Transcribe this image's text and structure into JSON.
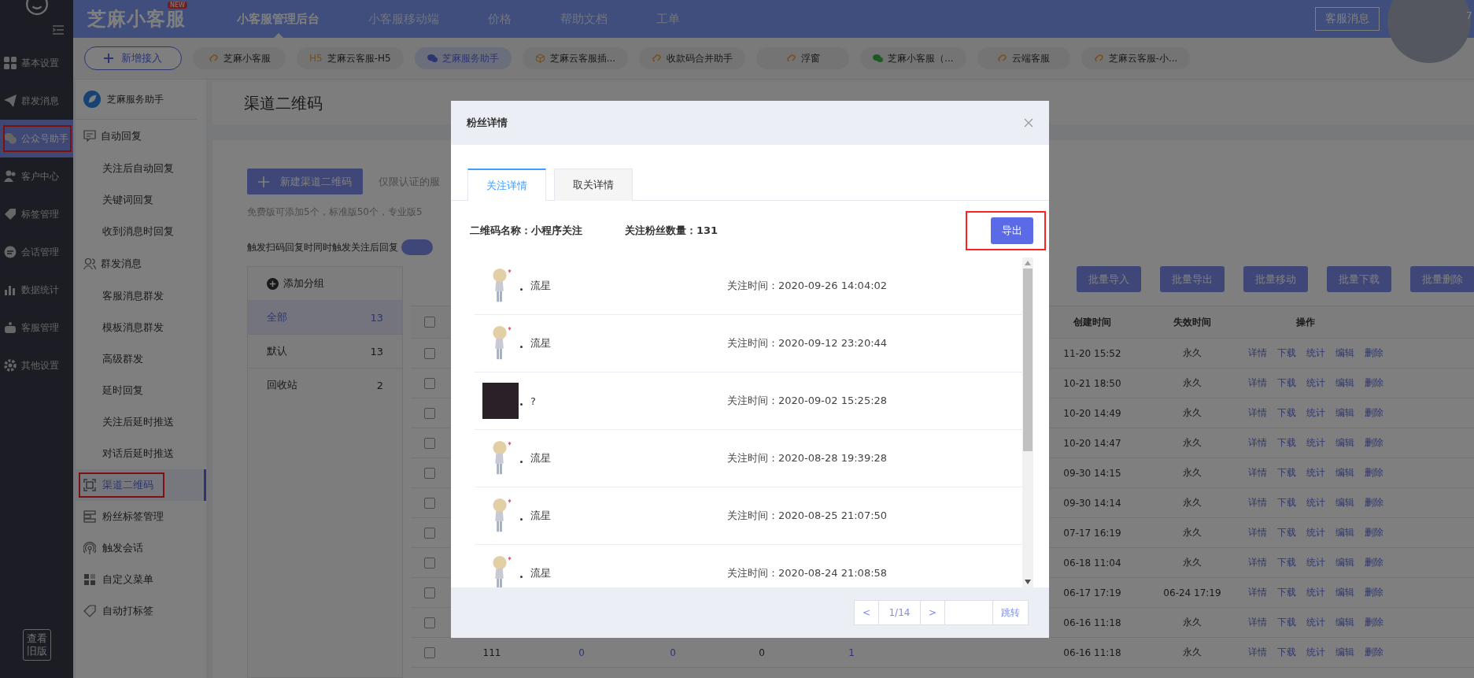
{
  "sidebar": {
    "items": [
      {
        "label": "基本设置",
        "selected": false,
        "highlighted": false
      },
      {
        "label": "群发消息",
        "selected": false,
        "highlighted": false
      },
      {
        "label": "公众号助手",
        "selected": true,
        "highlighted": true
      },
      {
        "label": "客户中心",
        "selected": false,
        "highlighted": false
      },
      {
        "label": "标签管理",
        "selected": false,
        "highlighted": false
      },
      {
        "label": "会话管理",
        "selected": false,
        "highlighted": false
      },
      {
        "label": "数据统计",
        "selected": false,
        "highlighted": false
      },
      {
        "label": "客服管理",
        "selected": false,
        "highlighted": false
      },
      {
        "label": "其他设置",
        "selected": false,
        "highlighted": false
      }
    ],
    "old_version_button": "查看旧版"
  },
  "top_nav": {
    "logo": "芝麻小客服",
    "badge": "NEW",
    "items": [
      {
        "label": "小客服管理后台",
        "selected": true
      },
      {
        "label": "小客服移动端",
        "selected": false
      },
      {
        "label": "价格",
        "selected": false
      },
      {
        "label": "帮助文档",
        "selected": false
      },
      {
        "label": "工单",
        "selected": false
      }
    ],
    "message_button": "客服消息",
    "corner_text": "7"
  },
  "channels": {
    "add_button": "新增接入",
    "items": [
      {
        "kind": "link",
        "label": "芝麻小客服",
        "selected": false
      },
      {
        "kind": "h5",
        "prefix": "H5",
        "label": "芝麻云客服-H5",
        "selected": false
      },
      {
        "kind": "wechat",
        "label": "芝麻服务助手",
        "selected": true
      },
      {
        "kind": "box",
        "label": "芝麻云客服插...",
        "selected": false
      },
      {
        "kind": "link",
        "label": "收款码合并助手",
        "selected": false
      },
      {
        "kind": "link",
        "label": "浮窗",
        "selected": false
      },
      {
        "kind": "wechat",
        "label": "芝麻小客服（...",
        "selected": false
      },
      {
        "kind": "link",
        "label": "云端客服",
        "selected": false
      },
      {
        "kind": "link",
        "label": "芝麻云客服-小...",
        "selected": false
      }
    ]
  },
  "menu": {
    "title": "芝麻服务助手",
    "items": [
      {
        "kind": "group",
        "label": "自动回复",
        "children": [
          {
            "label": "关注后自动回复",
            "selected": false
          },
          {
            "label": "关键词回复",
            "selected": false
          },
          {
            "label": "收到消息时回复",
            "selected": false
          }
        ]
      },
      {
        "kind": "group",
        "label": "群发消息",
        "children": [
          {
            "label": "客服消息群发",
            "selected": false
          },
          {
            "label": "模板消息群发",
            "selected": false
          },
          {
            "label": "高级群发",
            "selected": false
          },
          {
            "label": "延时回复",
            "selected": false
          },
          {
            "label": "关注后延时推送",
            "selected": false
          },
          {
            "label": "对话后延时推送",
            "selected": false
          }
        ]
      },
      {
        "kind": "item",
        "label": "渠道二维码",
        "selected": true,
        "highlighted": true
      },
      {
        "kind": "item",
        "label": "粉丝标签管理",
        "selected": false,
        "highlighted": false
      },
      {
        "kind": "item",
        "label": "触发会话",
        "selected": false,
        "highlighted": false
      },
      {
        "kind": "item",
        "label": "自定义菜单",
        "selected": false,
        "highlighted": false
      },
      {
        "kind": "item",
        "label": "自动打标签",
        "selected": false,
        "highlighted": false
      }
    ]
  },
  "page": {
    "title": "渠道二维码",
    "new_button": "新建渠道二维码",
    "auth_note": "仅限认证的服",
    "quota_note": "免费版可添加5个，标准版50个，专业版5",
    "toggle_label": "触发扫码回复时同时触发关注后回复",
    "toggle_on": true
  },
  "groups": {
    "add_label": "添加分组",
    "items": [
      {
        "label": "全部",
        "count": "13",
        "selected": true
      },
      {
        "label": "默认",
        "count": "13",
        "selected": false
      },
      {
        "label": "回收站",
        "count": "2",
        "selected": false
      }
    ]
  },
  "batch_buttons": [
    "批量导入",
    "批量导出",
    "批量移动",
    "批量下载",
    "批量删除"
  ],
  "table": {
    "header_checked": false,
    "columns": [
      "创建时间",
      "失效时间",
      "操作"
    ],
    "rows": [
      {
        "checked": false,
        "created": "11-20 15:52",
        "expires": "永久",
        "actions": [
          "详情",
          "下载",
          "统计",
          "编辑",
          "删除"
        ]
      },
      {
        "checked": false,
        "created": "10-21 18:50",
        "expires": "永久",
        "actions": [
          "详情",
          "下载",
          "统计",
          "编辑",
          "删除"
        ]
      },
      {
        "checked": false,
        "created": "10-20 14:49",
        "expires": "永久",
        "actions": [
          "详情",
          "下载",
          "统计",
          "编辑",
          "删除"
        ]
      },
      {
        "checked": false,
        "created": "10-20 14:47",
        "expires": "永久",
        "actions": [
          "详情",
          "下载",
          "统计",
          "编辑",
          "删除"
        ]
      },
      {
        "checked": false,
        "created": "09-30 14:15",
        "expires": "永久",
        "actions": [
          "详情",
          "下载",
          "统计",
          "编辑",
          "删除"
        ]
      },
      {
        "checked": false,
        "created": "09-30 14:14",
        "expires": "永久",
        "actions": [
          "详情",
          "下载",
          "统计",
          "编辑",
          "删除"
        ]
      },
      {
        "checked": false,
        "created": "07-17 16:19",
        "expires": "永久",
        "actions": [
          "详情",
          "下载",
          "统计",
          "编辑",
          "删除"
        ]
      },
      {
        "checked": false,
        "created": "06-18 11:04",
        "expires": "永久",
        "actions": [
          "详情",
          "下载",
          "统计",
          "编辑",
          "删除"
        ]
      },
      {
        "checked": false,
        "created": "06-17 17:19",
        "expires": "06-24 17:19",
        "actions": [
          "详情",
          "下载",
          "统计",
          "编辑",
          "删除"
        ]
      },
      {
        "checked": false,
        "created": "06-16 11:18",
        "expires": "永久",
        "actions": [
          "详情",
          "下载",
          "统计",
          "编辑",
          "删除"
        ]
      },
      {
        "checked": false,
        "cells": [
          {
            "text": "111",
            "link": false
          },
          {
            "text": "0",
            "link": true
          },
          {
            "text": "0",
            "link": true
          },
          {
            "text": "0",
            "link": false
          },
          {
            "text": "1",
            "link": true
          }
        ],
        "created": "06-16 11:18",
        "expires": "永久",
        "actions": [
          "详情",
          "下载",
          "统计",
          "编辑",
          "删除"
        ]
      }
    ]
  },
  "modal": {
    "title": "粉丝详情",
    "tabs": [
      {
        "label": "关注详情",
        "selected": true
      },
      {
        "label": "取关详情",
        "selected": false
      }
    ],
    "qr_name": "二维码名称：小程序关注",
    "fan_count": "关注粉丝数量：131",
    "export_button": "导出",
    "export_highlighted": true,
    "fans": [
      {
        "kind": "cartoon",
        "name": "流星",
        "time": "关注时间：2020-09-26 14:04:02"
      },
      {
        "kind": "cartoon",
        "name": "流星",
        "time": "关注时间：2020-09-12 23:20:44"
      },
      {
        "kind": "photo",
        "name": "?",
        "time": "关注时间：2020-09-02 15:25:28"
      },
      {
        "kind": "cartoon",
        "name": "流星",
        "time": "关注时间：2020-08-28 19:39:28"
      },
      {
        "kind": "cartoon",
        "name": "流星",
        "time": "关注时间：2020-08-25 21:07:50"
      },
      {
        "kind": "cartoon",
        "name": "流星",
        "time": "关注时间：2020-08-24 21:08:58"
      }
    ],
    "pagination": {
      "prev": "<",
      "page": "1/14",
      "next": ">",
      "jump": "跳转"
    }
  }
}
